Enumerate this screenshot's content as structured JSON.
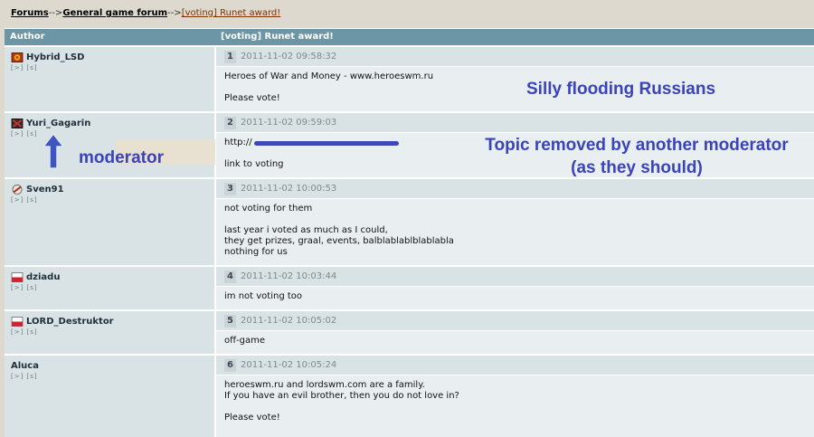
{
  "breadcrumb": {
    "forums": "Forums",
    "sep1": "-->",
    "general": "General game forum",
    "sep2": "-->",
    "current": "[voting] Runet award!"
  },
  "table_header": {
    "author": "Author",
    "topic": "[voting] Runet award!"
  },
  "posts": [
    {
      "user": "Hybrid_LSD",
      "links": "[>] [s]",
      "num": "1",
      "date": "2011-11-02 09:58:32",
      "text": "Heroes of War and Money - www.heroeswm.ru\n\nPlease vote!"
    },
    {
      "user": "Yuri_Gagarin",
      "links": "[>] [s]",
      "num": "2",
      "date": "2011-11-02 09:59:03",
      "text": "http://\n\nlink to voting"
    },
    {
      "user": "Sven91",
      "links": "[>] [s]",
      "num": "3",
      "date": "2011-11-02 10:00:53",
      "text": "not voting for them\n\nlast year i voted as much as I could,\nthey get prizes, graal, events, balblablablblablabla\nnothing for us"
    },
    {
      "user": "dziadu",
      "links": "[>] [s]",
      "num": "4",
      "date": "2011-11-02 10:03:44",
      "text": "im not voting too"
    },
    {
      "user": "LORD_Destruktor",
      "links": "[>] [s]",
      "num": "5",
      "date": "2011-11-02 10:05:02",
      "text": "off-game"
    },
    {
      "user": "Aluca",
      "links": "[>] [s]",
      "num": "6",
      "date": "2011-11-02 10:05:24",
      "text": "heroeswm.ru and lordswm.com are a family.\nIf you have an evil brother, then you do not love in?\n\nPlease vote!"
    }
  ],
  "annotations": {
    "flood": "Silly flooding Russians",
    "moderator": "moderator",
    "removed_line1": "Topic removed by another moderator",
    "removed_line2": "(as they should)"
  },
  "colors": {
    "header": "#6c95a6",
    "annotation": "#3a43b8",
    "arrow": "#3e56c0"
  }
}
